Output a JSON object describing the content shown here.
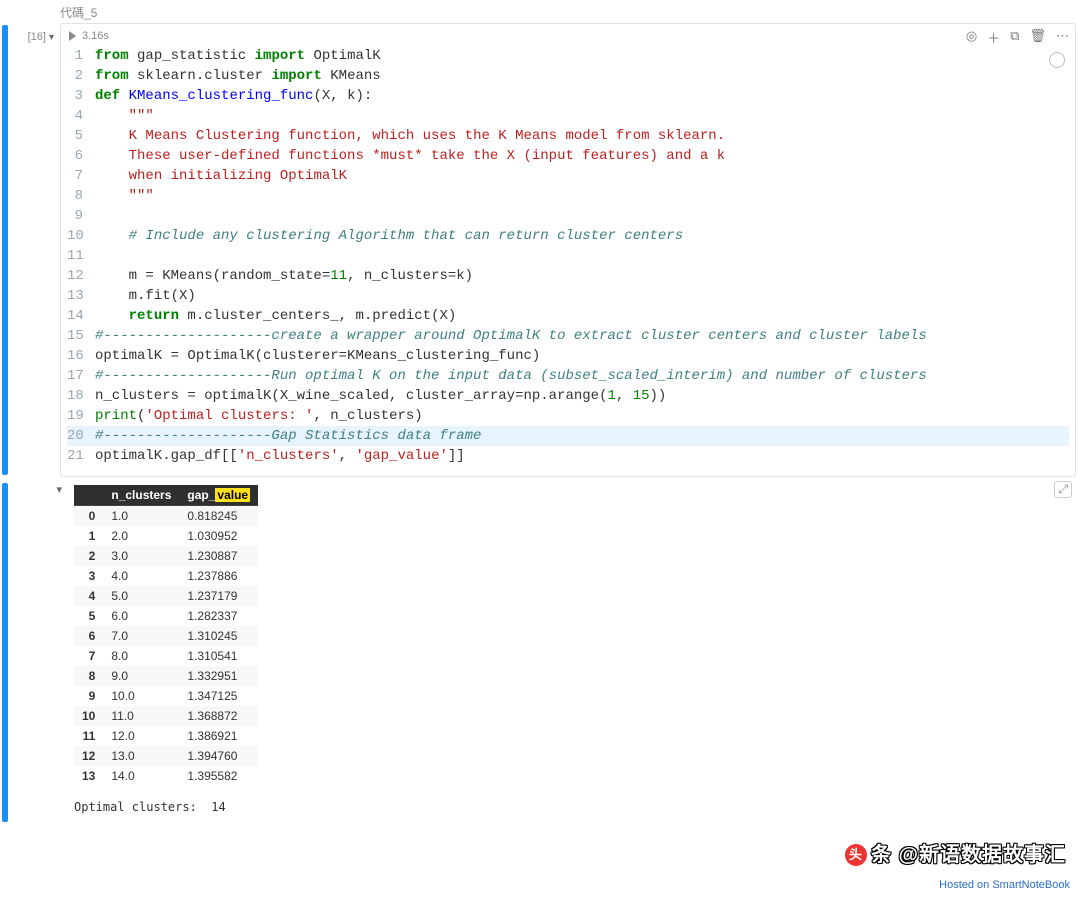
{
  "cell": {
    "label": "代碼_5",
    "exec_count": "[16]",
    "exec_time": "3.16s",
    "highlight_line": 20,
    "code_lines": [
      [
        [
          "kw",
          "from"
        ],
        [
          "pl",
          " gap_statistic "
        ],
        [
          "kw",
          "import"
        ],
        [
          "pl",
          " OptimalK"
        ]
      ],
      [
        [
          "kw",
          "from"
        ],
        [
          "pl",
          " sklearn.cluster "
        ],
        [
          "kw",
          "import"
        ],
        [
          "pl",
          " KMeans"
        ]
      ],
      [
        [
          "def",
          "def"
        ],
        [
          "pl",
          " "
        ],
        [
          "fn",
          "KMeans_clustering_func"
        ],
        [
          "pl",
          "(X, k):"
        ]
      ],
      [
        [
          "pl",
          "    "
        ],
        [
          "str",
          "\"\"\""
        ]
      ],
      [
        [
          "pl",
          "    "
        ],
        [
          "str",
          "K Means Clustering function, which uses the K Means model from sklearn."
        ]
      ],
      [
        [
          "pl",
          "    "
        ],
        [
          "str",
          "These user-defined functions *must* take the X (input features) and a k"
        ]
      ],
      [
        [
          "pl",
          "    "
        ],
        [
          "str",
          "when initializing OptimalK"
        ]
      ],
      [
        [
          "pl",
          "    "
        ],
        [
          "str",
          "\"\"\""
        ]
      ],
      [
        [
          "pl",
          ""
        ]
      ],
      [
        [
          "pl",
          "    "
        ],
        [
          "cm",
          "# Include any clustering Algorithm that can return cluster centers"
        ]
      ],
      [
        [
          "pl",
          ""
        ]
      ],
      [
        [
          "pl",
          "    m = KMeans(random_state="
        ],
        [
          "num",
          "11"
        ],
        [
          "pl",
          ", n_clusters=k)"
        ]
      ],
      [
        [
          "pl",
          "    m.fit(X)"
        ]
      ],
      [
        [
          "pl",
          "    "
        ],
        [
          "kw",
          "return"
        ],
        [
          "pl",
          " m.cluster_centers_, m.predict(X)"
        ]
      ],
      [
        [
          "cm",
          "#--------------------create a wrapper around OptimalK to extract cluster centers and cluster labels"
        ]
      ],
      [
        [
          "pl",
          "optimalK = OptimalK(clusterer=KMeans_clustering_func)"
        ]
      ],
      [
        [
          "cm",
          "#--------------------Run optimal K on the input data (subset_scaled_interim) and number of clusters"
        ]
      ],
      [
        [
          "pl",
          "n_clusters = optimalK(X_wine_scaled, cluster_array=np.arange("
        ],
        [
          "num",
          "1"
        ],
        [
          "pl",
          ", "
        ],
        [
          "num",
          "15"
        ],
        [
          "pl",
          "))"
        ]
      ],
      [
        [
          "bi",
          "print"
        ],
        [
          "pl",
          "("
        ],
        [
          "str",
          "'Optimal clusters: '"
        ],
        [
          "pl",
          ", n_clusters)"
        ]
      ],
      [
        [
          "cm",
          "#--------------------Gap Statistics data frame"
        ]
      ],
      [
        [
          "pl",
          "optimalK.gap_df[["
        ],
        [
          "str",
          "'n_clusters'"
        ],
        [
          "pl",
          ", "
        ],
        [
          "str",
          "'gap_value'"
        ],
        [
          "pl",
          "]]"
        ]
      ]
    ]
  },
  "toolbar": {
    "view_icon": "view-icon",
    "add_icon": "add-icon",
    "copy_icon": "copy-icon",
    "delete_icon": "delete-icon",
    "more_icon": "more-icon"
  },
  "output": {
    "columns": [
      "n_clusters",
      "gap_value"
    ],
    "header_highlight": "value",
    "rows": [
      {
        "idx": "0",
        "n_clusters": "1.0",
        "gap_value": "0.818245"
      },
      {
        "idx": "1",
        "n_clusters": "2.0",
        "gap_value": "1.030952"
      },
      {
        "idx": "2",
        "n_clusters": "3.0",
        "gap_value": "1.230887"
      },
      {
        "idx": "3",
        "n_clusters": "4.0",
        "gap_value": "1.237886"
      },
      {
        "idx": "4",
        "n_clusters": "5.0",
        "gap_value": "1.237179"
      },
      {
        "idx": "5",
        "n_clusters": "6.0",
        "gap_value": "1.282337"
      },
      {
        "idx": "6",
        "n_clusters": "7.0",
        "gap_value": "1.310245"
      },
      {
        "idx": "7",
        "n_clusters": "8.0",
        "gap_value": "1.310541"
      },
      {
        "idx": "8",
        "n_clusters": "9.0",
        "gap_value": "1.332951"
      },
      {
        "idx": "9",
        "n_clusters": "10.0",
        "gap_value": "1.347125"
      },
      {
        "idx": "10",
        "n_clusters": "11.0",
        "gap_value": "1.368872"
      },
      {
        "idx": "11",
        "n_clusters": "12.0",
        "gap_value": "1.386921"
      },
      {
        "idx": "12",
        "n_clusters": "13.0",
        "gap_value": "1.394760"
      },
      {
        "idx": "13",
        "n_clusters": "14.0",
        "gap_value": "1.395582"
      }
    ],
    "stdout": "Optimal clusters:  14"
  },
  "watermark": {
    "logo": "头",
    "text": "条 @新语数据故事汇"
  },
  "footer": "Hosted on SmartNoteBook"
}
